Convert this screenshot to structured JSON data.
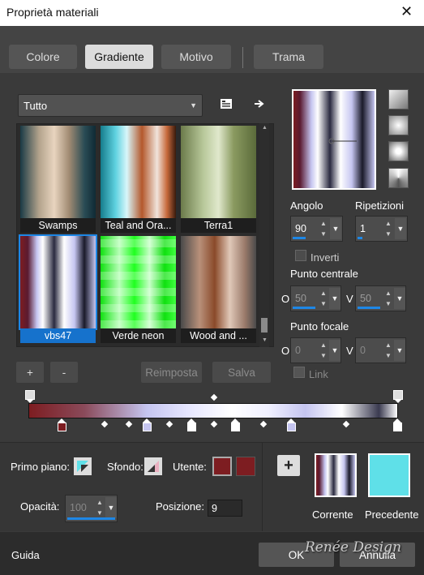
{
  "window": {
    "title": "Proprietà materiali",
    "close": "✕"
  },
  "tabs": [
    {
      "label": "Colore",
      "active": false
    },
    {
      "label": "Gradiente",
      "active": true
    },
    {
      "label": "Motivo",
      "active": false
    },
    {
      "label": "Trama",
      "active": false
    }
  ],
  "category": {
    "value": "Tutto"
  },
  "gradients": [
    {
      "label": "Swamps"
    },
    {
      "label": "Teal and Ora..."
    },
    {
      "label": "Terra1"
    },
    {
      "label": "vbs47",
      "selected": true
    },
    {
      "label": "Verde neon"
    },
    {
      "label": "Wood and ..."
    }
  ],
  "list_buttons": {
    "add": "+",
    "remove": "-",
    "reset": "Reimposta",
    "save": "Salva"
  },
  "angle": {
    "label": "Angolo",
    "value": "90"
  },
  "repeats": {
    "label": "Ripetizioni",
    "value": "1"
  },
  "invert": {
    "label": "Inverti",
    "checked": false
  },
  "center": {
    "label": "Punto centrale",
    "h_label": "O",
    "h_value": "50",
    "v_label": "V",
    "v_value": "50"
  },
  "focal": {
    "label": "Punto focale",
    "h_label": "O",
    "h_value": "0",
    "v_label": "V",
    "v_value": "0"
  },
  "link": {
    "label": "Link"
  },
  "stops": {
    "foreground": {
      "label": "Primo piano:"
    },
    "background": {
      "label": "Sfondo:"
    },
    "user": {
      "label": "Utente:",
      "color": "#7d1d21"
    },
    "opacity": {
      "label": "Opacità:",
      "value": "100"
    },
    "position": {
      "label": "Posizione:",
      "value": "9"
    }
  },
  "compare": {
    "add": "+",
    "current": "Corrente",
    "previous": "Precedente",
    "previous_color": "#5fe0e8"
  },
  "footer": {
    "help": "Guida",
    "ok": "OK",
    "cancel": "Annulla",
    "watermark": "Renée Design"
  },
  "colors": {
    "accent": "#1e87e6",
    "dark_red": "#7d1d21",
    "lavender": "#c5c5f0"
  }
}
